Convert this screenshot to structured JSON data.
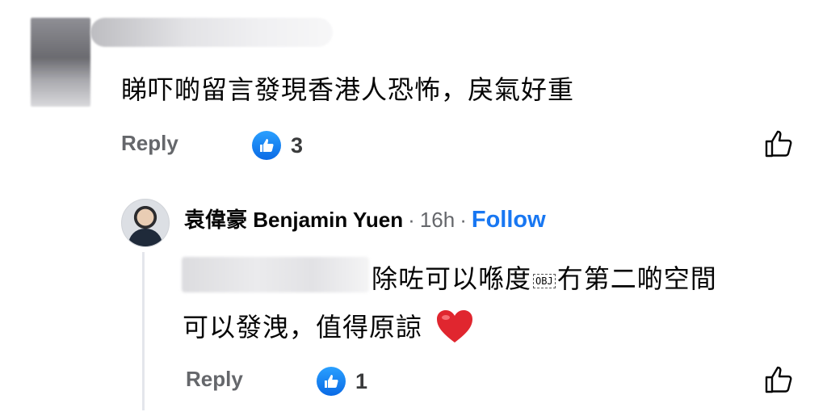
{
  "comment": {
    "text": "睇吓啲留言發現香港人恐怖，戾氣好重",
    "reply_label": "Reply",
    "reaction_count": "3"
  },
  "reply": {
    "author": "袁偉豪 Benjamin Yuen",
    "separator": "·",
    "time": "16h",
    "follow_label": "Follow",
    "text_start": "除咗可以喺度",
    "obj_placeholder": "OBJ",
    "text_end": "冇第二啲空間",
    "text_line2": "可以發洩，值得原諒",
    "reply_label": "Reply",
    "reaction_count": "1"
  },
  "colors": {
    "link_blue": "#1877f2",
    "secondary_text": "#65676b",
    "like_badge": "#1877f2",
    "heart": "#e0262f"
  },
  "icons": {
    "reaction": "thumbs-up-icon",
    "like_button": "thumbs-up-outline-icon",
    "heart": "red-heart-emoji"
  }
}
